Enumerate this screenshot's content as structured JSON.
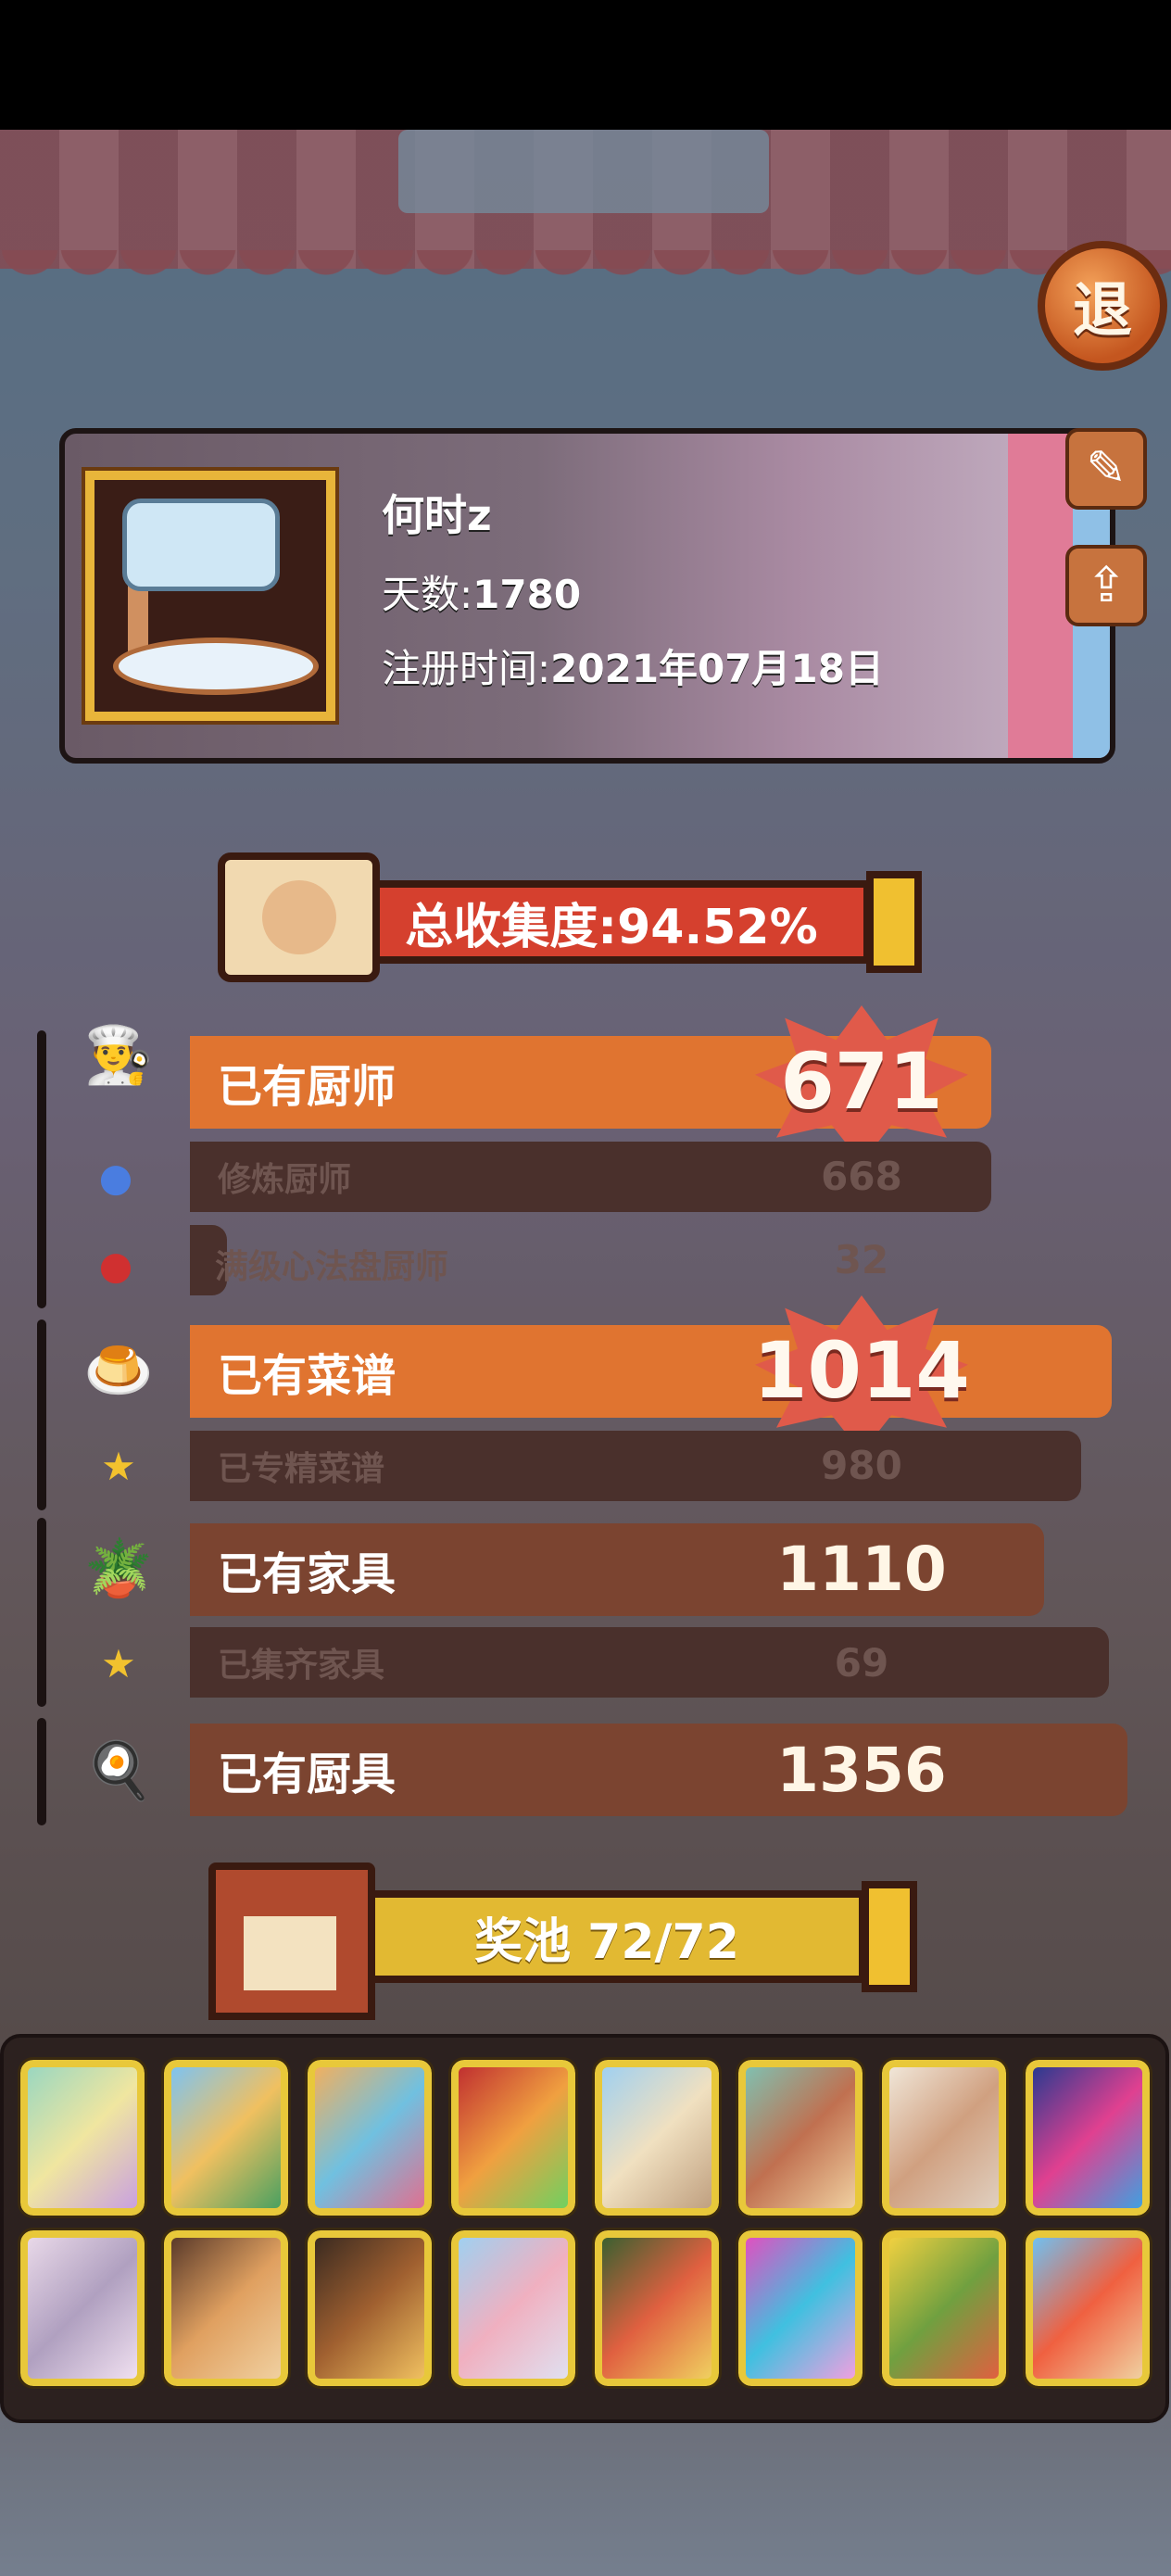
{
  "header": {
    "exit_label": "退"
  },
  "profile": {
    "name": "何时z",
    "days_label": "天数:",
    "days_value": "1780",
    "register_label": "注册时间:",
    "register_value": "2021年07月18日",
    "edit_icon": "edit-icon",
    "share_icon": "share-icon"
  },
  "collection": {
    "label": "总收集度:94.52%"
  },
  "chefs": {
    "label": "已有厨师",
    "value": "671",
    "sub": [
      {
        "label": "修炼厨师",
        "value": "668",
        "icon": "blue-figure-icon"
      },
      {
        "label": "满级心法盘厨师",
        "value": "32",
        "icon": "red-figure-icon"
      }
    ]
  },
  "recipes": {
    "label": "已有菜谱",
    "value": "1014",
    "sub": [
      {
        "label": "已专精菜谱",
        "value": "980",
        "icon": "star-icon"
      }
    ]
  },
  "furniture": {
    "label": "已有家具",
    "value": "1110",
    "sub": [
      {
        "label": "已集齐家具",
        "value": "69",
        "icon": "star-icon"
      }
    ]
  },
  "tools": {
    "label": "已有厨具",
    "value": "1356"
  },
  "pool": {
    "label": "奖池  72/72"
  },
  "colors": {
    "orange_bar": "#e07430",
    "brown_bar": "#7b4430",
    "panel_bg": "#3a2522",
    "gold_frame": "#e8c83a"
  }
}
